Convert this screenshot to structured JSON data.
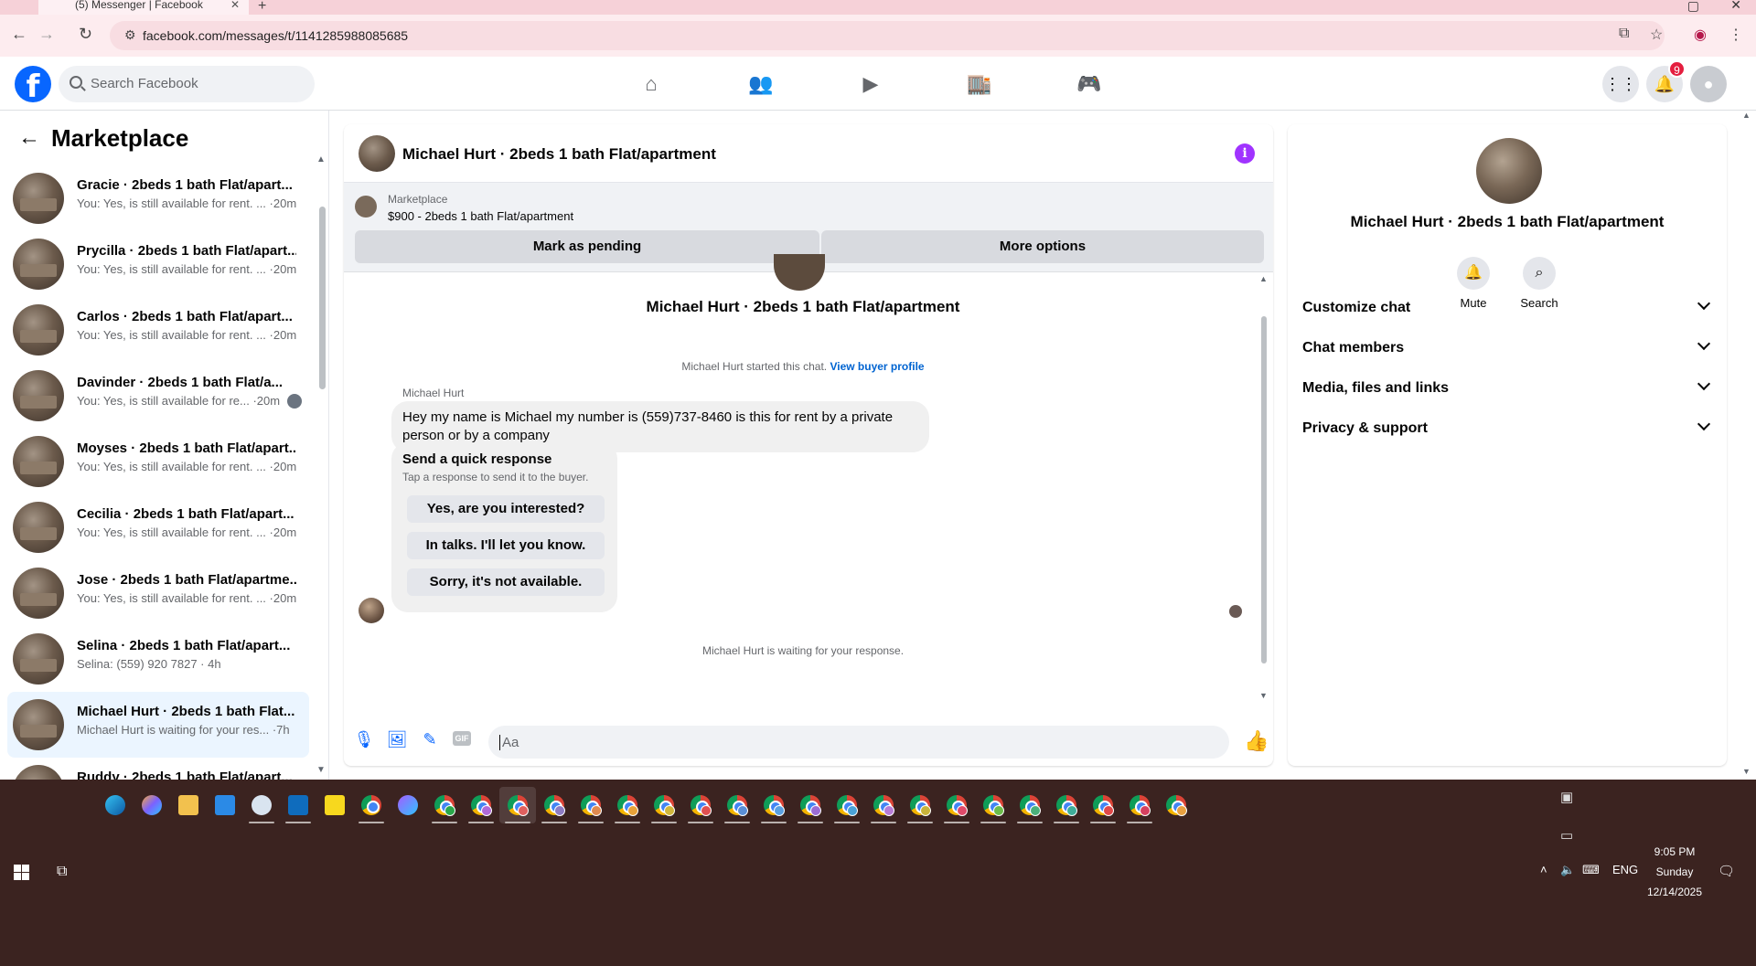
{
  "browser": {
    "tab_title": "(5) Messenger | Facebook",
    "url": "facebook.com/messages/t/1141285988085685",
    "new_tab": "+",
    "tab_close": "✕"
  },
  "fb_header": {
    "logo": "f",
    "search_placeholder": "Search Facebook",
    "nav_icons": [
      "home-icon",
      "friends-icon",
      "video-icon",
      "marketplace-icon",
      "gaming-icon"
    ],
    "notifications_count": "9"
  },
  "sidebar": {
    "title": "Marketplace",
    "conversations": [
      {
        "name": "Gracie · 2beds 1 bath Flat/apart...",
        "snippet": "You: Yes, is still available for rent. ... ·20m"
      },
      {
        "name": "Prycilla · 2beds 1 bath Flat/apart...",
        "snippet": "You: Yes, is still available for rent. ... ·20m"
      },
      {
        "name": "Carlos · 2beds 1 bath Flat/apart...",
        "snippet": "You: Yes, is still available for rent. ... ·20m"
      },
      {
        "name": "Davinder · 2beds 1 bath Flat/a...",
        "snippet": "You: Yes, is still available for re... ·20m"
      },
      {
        "name": "Moyses · 2beds 1 bath Flat/apart...",
        "snippet": "You: Yes, is still available for rent. ... ·20m"
      },
      {
        "name": "Cecilia · 2beds 1 bath Flat/apart...",
        "snippet": "You: Yes, is still available for rent. ... ·20m"
      },
      {
        "name": "Jose · 2beds 1 bath Flat/apartme...",
        "snippet": "You: Yes, is still available for rent. ... ·20m"
      },
      {
        "name": "Selina · 2beds 1 bath Flat/apart...",
        "snippet": "Selina: (559) 920 7827 · 4h"
      },
      {
        "name": "Michael Hurt · 2beds 1 bath Flat...",
        "snippet": "Michael Hurt is waiting for your res... ·7h"
      },
      {
        "name": "Ruddy · 2beds 1 bath Flat/apart...",
        "snippet": ""
      }
    ]
  },
  "chat": {
    "title": "Michael Hurt · 2beds 1 bath Flat/apartment",
    "marketplace_label": "Marketplace",
    "listing": "$900 - 2beds 1 bath Flat/apartment",
    "mark_pending": "Mark as pending",
    "more_options": "More options",
    "intro_title": "Michael Hurt · 2beds 1 bath Flat/apartment",
    "started_text": "Michael Hurt started this chat.",
    "view_profile": "View buyer profile",
    "sender_name": "Michael Hurt",
    "message": "Hey my name is Michael my number is (559)737-8460 is this for rent by a private person or by a company",
    "quick_title": "Send a quick response",
    "quick_sub": "Tap a response to send it to the buyer.",
    "quick_replies": [
      "Yes, are you interested?",
      "In talks. I'll let you know.",
      "Sorry, it's not available."
    ],
    "waiting": "Michael Hurt is waiting for your response.",
    "composer_placeholder": "Aa",
    "gif_label": "GIF"
  },
  "details": {
    "name": "Michael Hurt · 2beds 1 bath Flat/apartment",
    "mute": "Mute",
    "search": "Search",
    "sections": [
      "Customize chat",
      "Chat members",
      "Media, files and links",
      "Privacy & support"
    ]
  },
  "taskbar": {
    "time": "9:05 PM",
    "day": "Sunday",
    "date": "12/14/2025",
    "lang": "ENG"
  },
  "colors": {
    "fb_blue": "#0866ff",
    "active_conv": "#ebf5ff",
    "info_purple": "#a033ff",
    "taskbar": "#3b2320",
    "notif_red": "#e41e3f"
  }
}
